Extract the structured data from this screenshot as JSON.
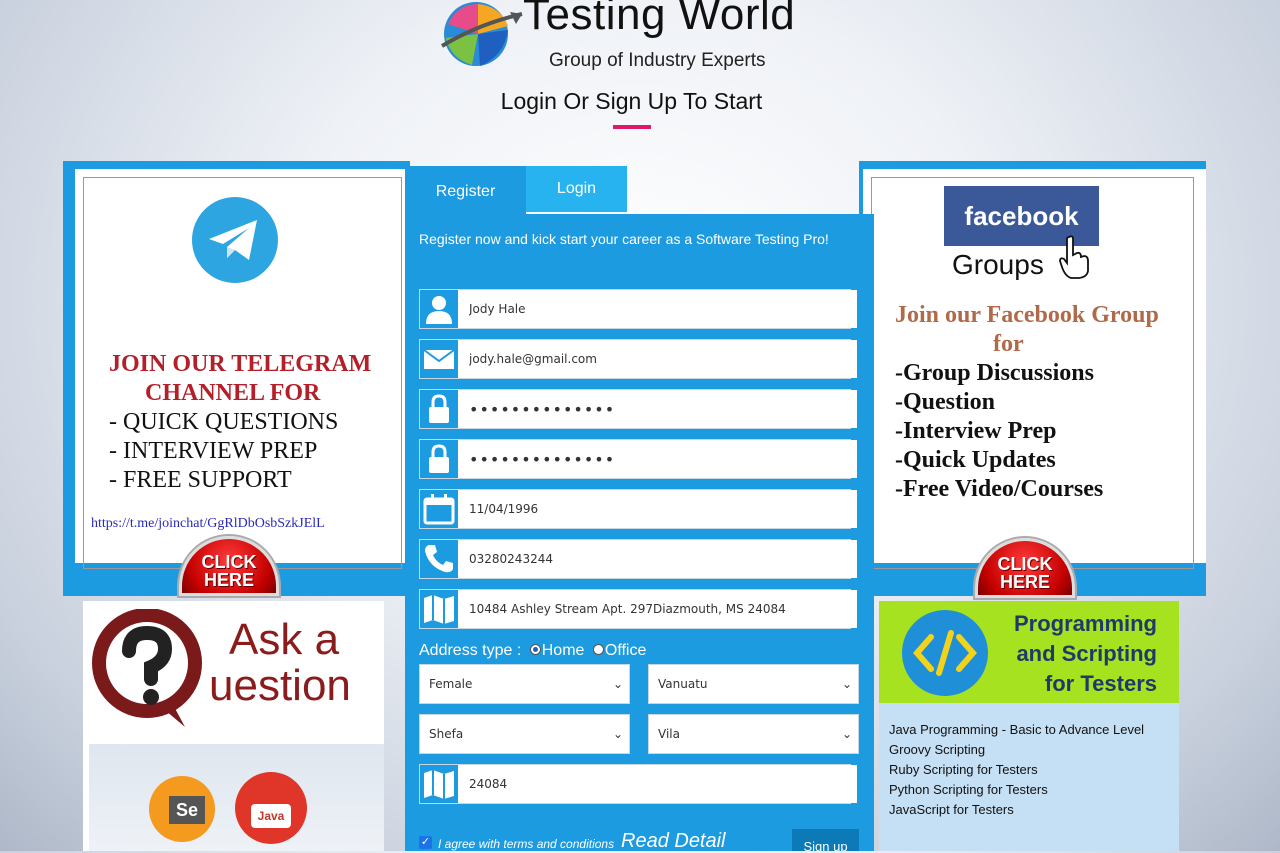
{
  "header": {
    "logo_title": "Testing World",
    "logo_subtitle": "Group of Industry Experts",
    "heading": "Login Or Sign Up To Start"
  },
  "telegram_panel": {
    "line1": "JOIN OUR TELEGRAM",
    "line2": "CHANNEL  FOR",
    "items": [
      "- QUICK QUESTIONS",
      "- INTERVIEW PREP",
      "- FREE SUPPORT"
    ],
    "link": "https://t.me/joinchat/GgRlDbOsbSzkJElL",
    "click_label": "CLICK HERE"
  },
  "facebook_panel": {
    "brand": "facebook",
    "groups_label": "Groups",
    "line1": "Join our Facebook Group",
    "line2": "for",
    "items": [
      "-Group Discussions",
      "-Question",
      "-Interview Prep",
      "-Quick Updates",
      "-Free Video/Courses"
    ],
    "click_label": "CLICK HERE"
  },
  "tabs": {
    "register": "Register",
    "login": "Login"
  },
  "form": {
    "intro": "Register now and kick start your career as a Software Testing Pro!",
    "name": "Jody Hale",
    "email": "jody.hale@gmail.com",
    "password": "••••••••••••••",
    "confirm_password": "••••••••••••••",
    "dob": "11/04/1996",
    "phone": "03280243244",
    "address": "10484 Ashley Stream Apt. 297Diazmouth, MS 24084",
    "address_type_label": "Address type :",
    "address_type_home": "Home",
    "address_type_office": "Office",
    "gender": "Female",
    "country": "Vanuatu",
    "state": "Shefa",
    "city": "Vila",
    "zip": "24084",
    "agree_text": "I agree with terms and conditions",
    "read_detail": "Read Detail",
    "signup": "Sign up"
  },
  "ask_card": {
    "title1": "Ask a",
    "title2": "uestion",
    "se_label": "Se",
    "java_label": "Java"
  },
  "prog_card": {
    "title1": "Programming",
    "title2": "and Scripting",
    "title3": "for Testers",
    "items": [
      "Java Programming - Basic to Advance Level",
      "Groovy Scripting",
      "Ruby Scripting for Testers",
      "Python Scripting for Testers",
      "JavaScript for Testers"
    ]
  }
}
